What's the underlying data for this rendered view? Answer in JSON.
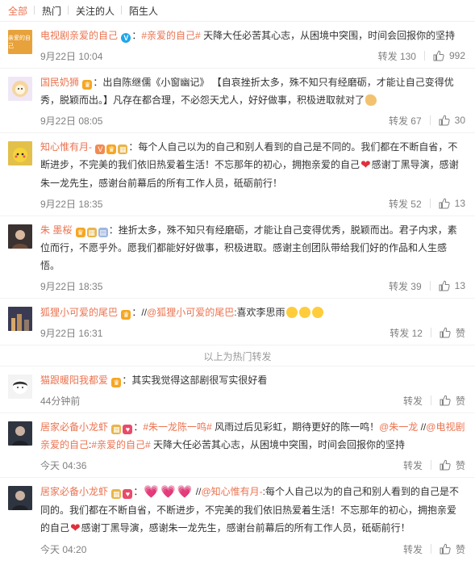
{
  "tabs": [
    {
      "label": "全部",
      "active": true
    },
    {
      "label": "热门",
      "active": false
    },
    {
      "label": "关注的人",
      "active": false
    },
    {
      "label": "陌生人",
      "active": false
    }
  ],
  "posts": [
    {
      "avatar_text": "亲爱的自己",
      "avatar_color": "#e8a23b",
      "name": "电视剧亲爱的自己",
      "text_prefix": "：",
      "hashtag": "#亲爱的自己#",
      "text": " 天降大任必苦其心志，从困境中突围，时间会回报你的坚持",
      "time": "9月22日 10:04",
      "repost_label": "转发 130",
      "likes": "992"
    },
    {
      "avatar_color": "#efe7f5",
      "name": "国民奶狮",
      "text": "：出自陈继儒《小窗幽记》 【自哀挫折太多，殊不知只有经磨砺，才能让自己变得优秀，脱颖而出。】凡存在都合理，不必怨天尤人，好好做事，积极进取就对了",
      "time": "9月22日 08:05",
      "repost_label": "转发 67",
      "likes": "30"
    },
    {
      "avatar_color": "#e3c04a",
      "name": "知心惟有月-",
      "text_a": "：每个人自己以为的自己和别人看到的自己是不同的。我们都在不断自省，不断进步，不完美的我们依旧热爱着生活！不忘那年的初心，拥抱亲爱的自己",
      "text_b": "感谢丁黑导演，感谢朱一龙先生，感谢台前幕后的所有工作人员，砥砺前行！",
      "time": "9月22日 18:35",
      "repost_label": "转发 52",
      "likes": "13"
    },
    {
      "avatar_color": "#3a3230",
      "name": "朱 墨桜",
      "text": "：挫折太多，殊不知只有经磨砺，才能让自己变得优秀，脱颖而出。君子内求，素位而行，不愿乎外。愿我们都能好好做事，积极进取。感谢主创团队带给我们好的作品和人生感悟。",
      "time": "9月22日 18:35",
      "repost_label": "转发 39",
      "likes": "13"
    },
    {
      "avatar_color": "#4a4a5a",
      "name": "狐狸小可爱的尾巴",
      "text_prefix": "：//",
      "mention": "@狐狸小可爱的尾巴",
      "text": ":喜欢李思雨",
      "time": "9月22日 16:31",
      "repost_label": "转发 12",
      "likes": "赞"
    }
  ],
  "divider": "以上为热门转发",
  "posts2": [
    {
      "avatar_color": "#f3f3f3",
      "name": "猫跟暖阳我都爱",
      "text": "：其实我觉得这部剧很写实很好看",
      "time": "44分钟前",
      "repost_label": "转发",
      "likes": "赞"
    },
    {
      "avatar_color": "#2f3540",
      "name": "居家必备小龙虾",
      "text_prefix": "：",
      "hashtag": "#朱一龙陈一鸣#",
      "text_mid": " 风雨过后见彩虹，期待更好的陈一鸣！",
      "mention1": "@朱一龙",
      "sep": " //",
      "mention2": "@电视剧亲爱的自己",
      "colon": ":",
      "hashtag2": "#亲爱的自己#",
      "text_end": " 天降大任必苦其心志，从困境中突围，时间会回报你的坚持",
      "time": "今天 04:36",
      "repost_label": "转发",
      "likes": "赞"
    },
    {
      "avatar_color": "#2f3540",
      "name": "居家必备小龙虾",
      "text_prefix": "：",
      "sep": " //",
      "mention": "@知心惟有月-",
      "text_a": ":每个人自己以为的自己和别人看到的自己是不同的。我们都在不断自省，不断进步，不完美的我们依旧热爱着生活！不忘那年的初心，拥抱亲爱的自己",
      "text_b": "感谢丁黑导演，感谢朱一龙先生，感谢台前幕后的所有工作人员，砥砺前行！",
      "time": "今天 04:20",
      "repost_label": "转发",
      "likes": "赞"
    }
  ],
  "icons": {
    "like": "thumbs-up-icon",
    "verified": "verified-v-icon"
  },
  "colors": {
    "accent": "#eb7350",
    "text": "#333333",
    "meta": "#808080"
  }
}
